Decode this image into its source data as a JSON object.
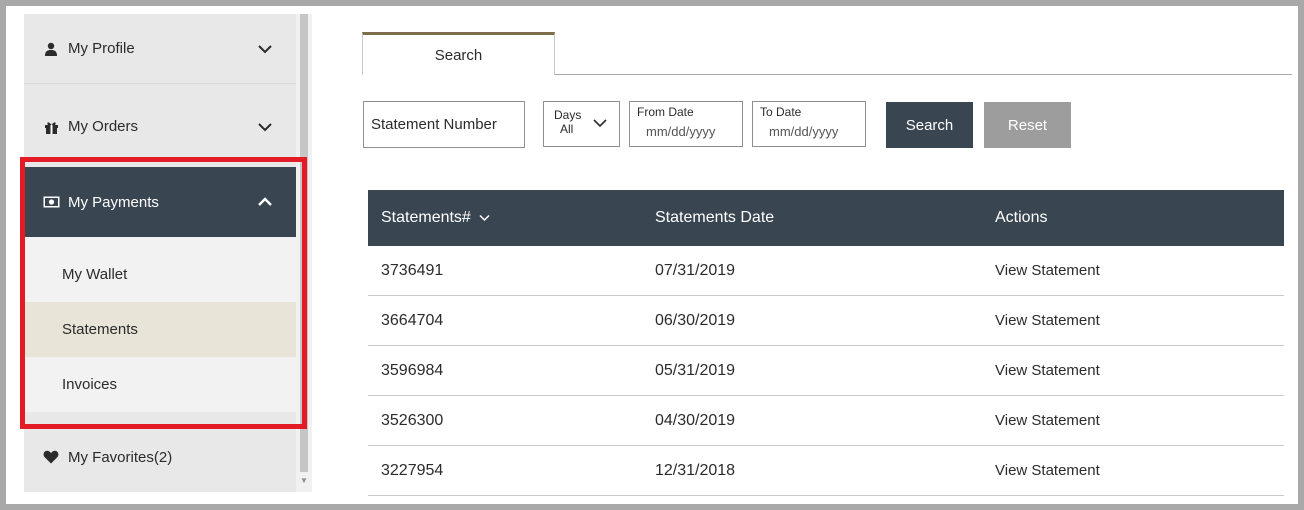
{
  "sidebar": {
    "profile": {
      "label": "My Profile",
      "icon": "user-icon"
    },
    "orders": {
      "label": "My Orders",
      "icon": "gift-icon"
    },
    "payments": {
      "label": "My Payments",
      "icon": "money-icon",
      "items": [
        {
          "label": "My Wallet"
        },
        {
          "label": "Statements"
        },
        {
          "label": "Invoices"
        }
      ]
    },
    "favorites": {
      "label": "My Favorites",
      "count": "(2)",
      "icon": "heart-icon"
    }
  },
  "tabs": [
    {
      "label": "Search"
    }
  ],
  "filters": {
    "statement_number": "Statement Number",
    "days": {
      "label": "Days",
      "value": "All"
    },
    "from_date": {
      "label": "From Date",
      "placeholder": "mm/dd/yyyy"
    },
    "to_date": {
      "label": "To Date",
      "placeholder": "mm/dd/yyyy"
    },
    "search_label": "Search",
    "reset_label": "Reset"
  },
  "table": {
    "headers": [
      "Statements#",
      "Statements Date",
      "Actions"
    ],
    "rows": [
      {
        "number": "3736491",
        "date": "07/31/2019",
        "action": "View Statement"
      },
      {
        "number": "3664704",
        "date": "06/30/2019",
        "action": "View Statement"
      },
      {
        "number": "3596984",
        "date": "05/31/2019",
        "action": "View Statement"
      },
      {
        "number": "3526300",
        "date": "04/30/2019",
        "action": "View Statement"
      },
      {
        "number": "3227954",
        "date": "12/31/2018",
        "action": "View Statement"
      }
    ]
  },
  "colors": {
    "nav_dark": "#394550",
    "highlight_box": "#e21b24",
    "selected_item": "#e8e4d8",
    "tab_accent": "#7d6f4c"
  }
}
